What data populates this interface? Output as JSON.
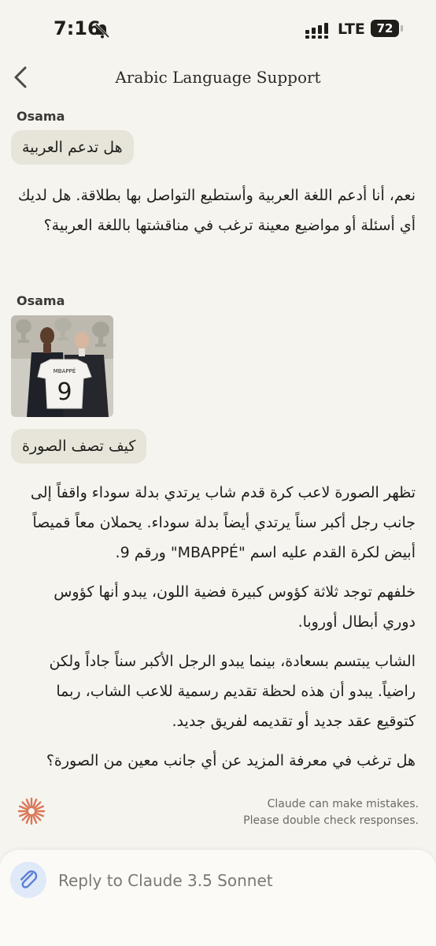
{
  "status_bar": {
    "time": "7:16",
    "network": "LTE",
    "battery": "72"
  },
  "header": {
    "title": "Arabic Language Support"
  },
  "messages": [
    {
      "sender": "Osama",
      "text": "هل تدعم العربية"
    },
    {
      "paragraphs": [
        "نعم، أنا أدعم اللغة العربية وأستطيع التواصل بها بطلاقة. هل لديك أي أسئلة أو مواضيع معينة ترغب في مناقشتها باللغة العربية؟"
      ]
    },
    {
      "sender": "Osama",
      "image": {
        "shirt_name": "MBAPPÉ",
        "shirt_number": "9"
      },
      "text": "كيف تصف الصورة"
    },
    {
      "paragraphs": [
        "تظهر الصورة لاعب كرة قدم شاب يرتدي بدلة سوداء واقفاً إلى جانب رجل أكبر سناً يرتدي أيضاً بدلة سوداء. يحملان معاً قميصاً أبيض لكرة القدم عليه اسم \"MBAPPÉ\" ورقم 9.",
        "خلفهم توجد ثلاثة كؤوس كبيرة فضية اللون، يبدو أنها كؤوس دوري أبطال أوروبا.",
        "الشاب يبتسم بسعادة، بينما يبدو الرجل الأكبر سناً جاداً ولكن راضياً. يبدو أن هذه لحظة تقديم رسمية للاعب الشاب، ربما كتوقيع عقد جديد أو تقديمه لفريق جديد.",
        "هل ترغب في معرفة المزيد عن أي جانب معين من الصورة؟"
      ]
    }
  ],
  "disclaimer": {
    "line1": "Claude can make mistakes.",
    "line2": "Please double check responses."
  },
  "composer": {
    "placeholder": "Reply to Claude 3.5 Sonnet"
  },
  "colors": {
    "accent": "#d97757",
    "bubble": "#e7e5da",
    "attach": "#5b7fd4",
    "background": "#f5f4ef"
  }
}
